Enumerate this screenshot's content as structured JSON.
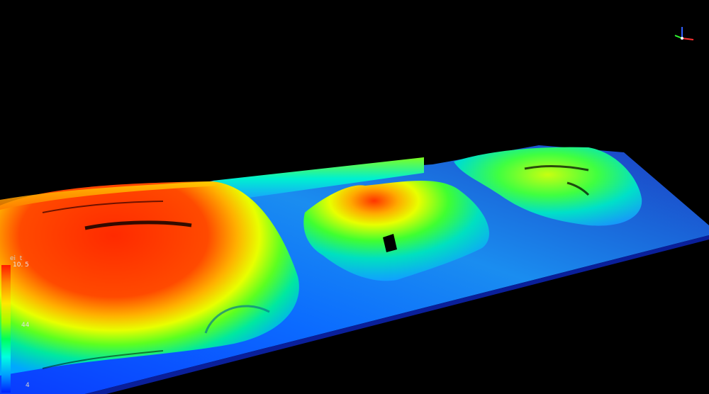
{
  "legend": {
    "title": "ei  t",
    "max": "10. 5",
    "mid": "44",
    "min": "4",
    "gradient": [
      "#ff1a00",
      "#ff8a00",
      "#ffe800",
      "#9cff00",
      "#00ff5a",
      "#00ffe0",
      "#00a0ff",
      "#0020ff"
    ]
  },
  "scene": {
    "background": "#000000",
    "description_icon": "terrain-point-cloud"
  },
  "axes": {
    "x_color": "#ff3030",
    "y_color": "#30ff30",
    "z_color": "#3060ff"
  }
}
